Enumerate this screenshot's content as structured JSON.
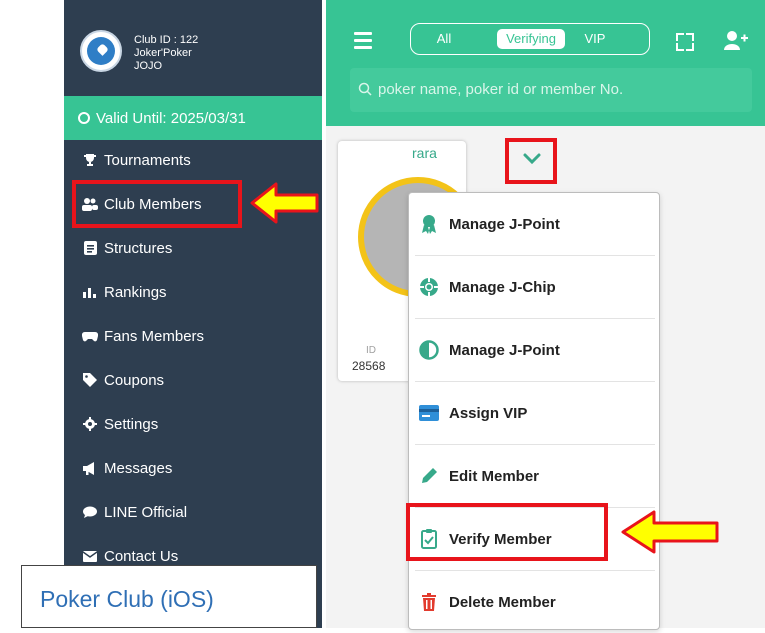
{
  "sidebar": {
    "club_id": "Club ID : 122",
    "club_name": "Joker'Poker",
    "club_owner": "JOJO",
    "valid_until": "Valid Until: 2025/03/31",
    "items": [
      {
        "label": "Tournaments",
        "icon": "trophy-icon"
      },
      {
        "label": "Club Members",
        "icon": "users-icon"
      },
      {
        "label": "Structures",
        "icon": "list-icon"
      },
      {
        "label": "Rankings",
        "icon": "bar-chart-icon"
      },
      {
        "label": "Fans Members",
        "icon": "gamepad-icon"
      },
      {
        "label": "Coupons",
        "icon": "tag-icon"
      },
      {
        "label": "Settings",
        "icon": "gear-icon"
      },
      {
        "label": "Messages",
        "icon": "megaphone-icon"
      },
      {
        "label": "LINE Official",
        "icon": "chat-icon"
      },
      {
        "label": "Contact Us",
        "icon": "envelope-icon"
      }
    ]
  },
  "header": {
    "tabs": [
      "All",
      "Verifying",
      "VIP"
    ],
    "active_tab": "Verifying",
    "search_placeholder": "poker name, poker id or member No."
  },
  "member_card": {
    "name": "rara",
    "id_label": "ID",
    "id_value": "28568"
  },
  "dropdown": {
    "items": [
      {
        "label": "Manage J-Point",
        "icon": "award-icon"
      },
      {
        "label": "Manage J-Chip",
        "icon": "chip-icon"
      },
      {
        "label": "Manage J-Point",
        "icon": "half-circle-icon"
      },
      {
        "label": "Assign VIP",
        "icon": "card-icon"
      },
      {
        "label": "Edit Member",
        "icon": "pencil-icon"
      },
      {
        "label": "Verify Member",
        "icon": "clipboard-icon"
      },
      {
        "label": "Delete Member",
        "icon": "trash-icon"
      }
    ]
  },
  "caption": "Poker Club (iOS)",
  "colors": {
    "sidebar_bg": "#2e3e50",
    "accent_green": "#37c494",
    "highlight_red": "#e8141b",
    "arrow_yellow": "#ffff00"
  }
}
